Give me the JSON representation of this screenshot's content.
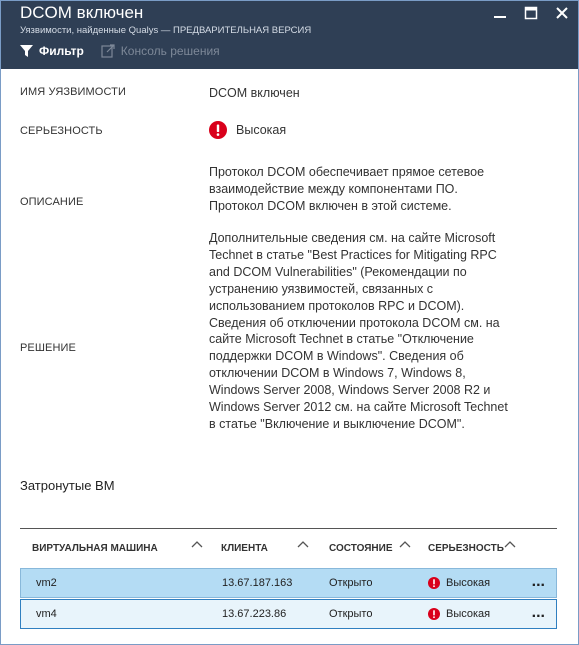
{
  "header": {
    "title": "DCOM включен",
    "subtitle": "Уязвимости, найденные Qualys — ПРЕДВАРИТЕЛЬНАЯ ВЕРСИЯ",
    "toolbar": {
      "filter_label": "Фильтр",
      "console_label": "Консоль решения"
    }
  },
  "details": {
    "name_label": "ИМЯ УЯЗВИМОСТИ",
    "name_value": "DCOM включен",
    "severity_label": "СЕРЬЕЗНОСТЬ",
    "severity_value": "Высокая",
    "description_label": "ОПИСАНИЕ",
    "description_value": "Протокол DCOM обеспечивает прямое сетевое\nвзаимодействие между компонентами ПО.\nПротокол DCOM включен в этой системе.",
    "solution_label": "РЕШЕНИЕ",
    "solution_value": "Дополнительные сведения см. на сайте Microsoft\nTechnet в статье \"Best Practices for Mitigating RPC\nand DCOM Vulnerabilities\" (Рекомендации по\nустранению уязвимостей, связанных с\nиспользованием протоколов RPC и DCOM).\nСведения об отключении протокола DCOM см. на\nсайте Microsoft Technet в статье \"Отключение\nподдержки DCOM в Windows\". Сведения об\nотключении DCOM в Windows 7, Windows 8,\nWindows Server 2008, Windows Server 2008 R2 и\nWindows Server 2012 см. на сайте Microsoft Technet\nв статье \"Включение и выключение DCOM\"."
  },
  "affected": {
    "title": "Затронутые ВМ",
    "columns": {
      "vm": "ВИРТУАЛЬНАЯ МАШИНА",
      "client": "КЛИЕНТА",
      "state": "СОСТОЯНИЕ",
      "severity": "СЕРЬЕЗНОСТЬ"
    },
    "rows": [
      {
        "vm": "vm2",
        "client": "13.67.187.163",
        "state": "Открыто",
        "severity": "Высокая",
        "more": "..."
      },
      {
        "vm": "vm4",
        "client": "13.67.223.86",
        "state": "Открыто",
        "severity": "Высокая",
        "more": "..."
      }
    ]
  },
  "colors": {
    "header_bg": "#2f3f55",
    "severity_red": "#d9001b",
    "row_selected": "#b4dcf4"
  },
  "icons": {
    "filter": "filter-icon",
    "console": "external-link-icon",
    "minimize": "minimize-icon",
    "maximize": "maximize-icon",
    "close": "close-icon",
    "severity": "error-circle-icon",
    "sort": "chevron-up-icon"
  }
}
